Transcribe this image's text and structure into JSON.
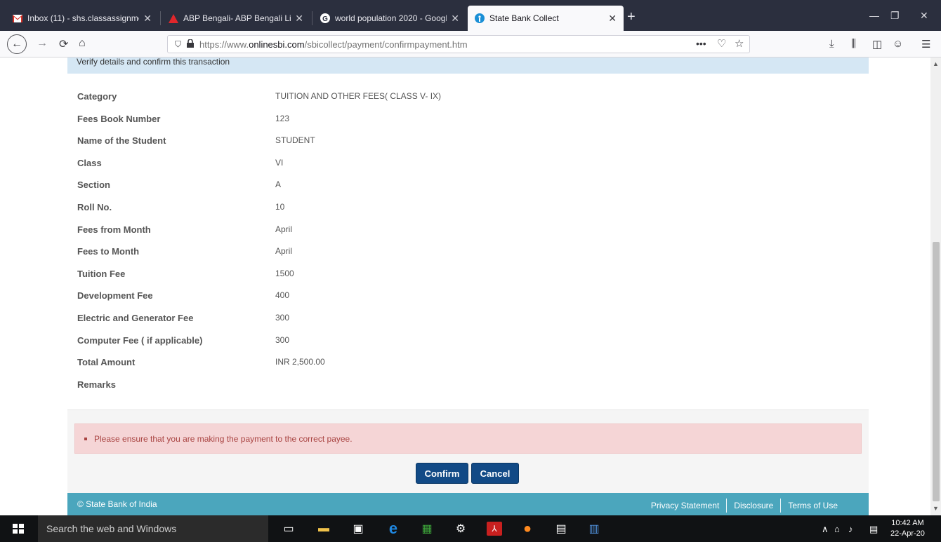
{
  "browser": {
    "tabs": [
      {
        "title": "Inbox (11) - shs.classassignmen",
        "icon": "gmail-icon",
        "active": false
      },
      {
        "title": "ABP Bengali- ABP Bengali Live",
        "icon": "abp-icon",
        "active": false
      },
      {
        "title": "world population 2020 - Googl",
        "icon": "google-icon",
        "active": false
      },
      {
        "title": "State Bank Collect",
        "icon": "sbi-icon",
        "active": true
      }
    ],
    "url_prefix": "https://www.",
    "url_domain": "onlinesbi.com",
    "url_path": "/sbicollect/payment/confirmpayment.htm"
  },
  "page": {
    "banner": "Verify details and confirm this transaction",
    "details": [
      {
        "label": "Category",
        "value": "TUITION AND OTHER FEES( CLASS V- IX)"
      },
      {
        "label": "Fees Book Number",
        "value": "123"
      },
      {
        "label": "Name of the Student",
        "value": "STUDENT"
      },
      {
        "label": "Class",
        "value": "VI"
      },
      {
        "label": "Section",
        "value": "A"
      },
      {
        "label": "Roll No.",
        "value": "10"
      },
      {
        "label": "Fees from Month",
        "value": "April"
      },
      {
        "label": "Fees to Month",
        "value": "April"
      },
      {
        "label": "Tuition Fee",
        "value": "1500"
      },
      {
        "label": "Development Fee",
        "value": "400"
      },
      {
        "label": "Electric and Generator Fee",
        "value": "300"
      },
      {
        "label": "Computer Fee ( if applicable)",
        "value": "300"
      },
      {
        "label": "Total Amount",
        "value": "INR 2,500.00"
      },
      {
        "label": "Remarks",
        "value": ""
      }
    ],
    "alert": "Please ensure that you are making the payment to the correct payee.",
    "confirm_label": "Confirm",
    "cancel_label": "Cancel",
    "footer": {
      "copyright": "© State Bank of India",
      "links": [
        "Privacy Statement",
        "Disclosure",
        "Terms of Use"
      ]
    }
  },
  "taskbar": {
    "search_placeholder": "Search the web and Windows",
    "time": "10:42 AM",
    "date": "22-Apr-20"
  },
  "colors": {
    "primary_button": "#124a86",
    "footer": "#4ba6bd",
    "alert_bg": "#f5d5d6",
    "banner_bg": "#d5e7f4"
  }
}
